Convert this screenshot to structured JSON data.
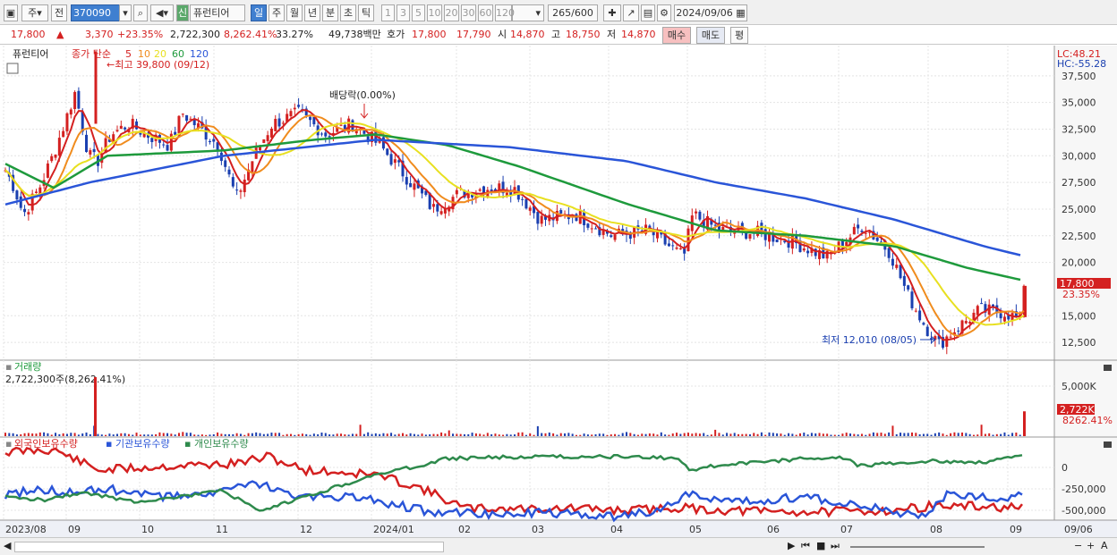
{
  "toolbar": {
    "code_prefix": "주",
    "code_type": "전",
    "stock_code": "370090",
    "credit_badge": "신",
    "stock_name": "퓨런티어",
    "periods": [
      "일",
      "주",
      "월",
      "년",
      "분",
      "초",
      "틱"
    ],
    "selected_period": "일",
    "intervals": [
      "1",
      "3",
      "5",
      "10",
      "20",
      "30",
      "60",
      "120"
    ],
    "count": "265",
    "count_total": "/600",
    "date": "2024/09/06"
  },
  "quote": {
    "price": "17,800",
    "change": "3,370",
    "change_pct": "+23.35%",
    "volume": "2,722,300",
    "volume_ratio": "8,262.41%",
    "turnover": "33.27%",
    "amount": "49,738백만",
    "ask_label": "호가",
    "ask": "17,800",
    "bid": "17,790",
    "open_label": "시",
    "open": "14,870",
    "high_label": "고",
    "high": "18,750",
    "low_label": "저",
    "low": "14,870",
    "buy_button": "매수",
    "sell_button": "매도",
    "eval_button": "평"
  },
  "price_panel": {
    "name_tag": "퓨런티어",
    "legend_prefix": "종가 단순",
    "ma_periods": [
      "5",
      "10",
      "20",
      "60",
      "120"
    ],
    "ma_colors": [
      "#d42020",
      "#f08c1e",
      "#e8e020",
      "#1e9a3c",
      "#2a55d8"
    ],
    "lc": "LC:48.21",
    "hc": "HC:-55.28",
    "max_annot": "최고 39,800 (09/12)",
    "min_annot": "최저 12,010 (08/05)",
    "dividend_annot": "배당락(0.00%)",
    "yticks": [
      "37,500",
      "35,000",
      "32,500",
      "30,000",
      "27,500",
      "25,000",
      "22,500",
      "20,000",
      "15,000",
      "12,500"
    ],
    "last_price": "17,800",
    "last_pct": "23.35%"
  },
  "volume_panel": {
    "title": "거래량",
    "value": "2,722,300주(8,262.41%)",
    "ytick": "5,000K",
    "last_volume": "2,722K",
    "last_pct": "8262.41%"
  },
  "holdings_panel": {
    "legend": [
      "외국인보유수량",
      "기관보유수량",
      "개인보유수량"
    ],
    "colors": [
      "#d42020",
      "#2a55d8",
      "#2e8a4c"
    ],
    "yticks": [
      "0",
      "-250,000",
      "-500,000"
    ]
  },
  "xaxis": [
    "2023/08",
    "09",
    "10",
    "11",
    "12",
    "2024/01",
    "02",
    "03",
    "04",
    "05",
    "06",
    "07",
    "08",
    "09",
    "09/06"
  ],
  "chart_data": {
    "type": "line",
    "title": "퓨런티어 (370090) 일봉",
    "x": [
      "2023/08",
      "09",
      "10",
      "11",
      "12",
      "2024/01",
      "02",
      "03",
      "04",
      "05",
      "06",
      "07",
      "08",
      "09",
      "2024/09/06"
    ],
    "series": [
      {
        "name": "종가",
        "values": [
          28500,
          31500,
          30500,
          29500,
          32500,
          32000,
          27500,
          24500,
          23000,
          23500,
          22500,
          22800,
          13500,
          15500,
          17800
        ]
      },
      {
        "name": "120",
        "values": [
          25400,
          26500,
          28000,
          29500,
          30500,
          31500,
          31000,
          30500,
          29500,
          28000,
          26000,
          25000,
          23000,
          21500,
          20800
        ]
      }
    ],
    "volume_highlight": {
      "date": "2024/09/06",
      "value": 2722300
    },
    "max": {
      "value": 39800,
      "date": "09/12"
    },
    "min": {
      "value": 12010,
      "date": "08/05"
    },
    "ylim": [
      11000,
      40000
    ]
  }
}
